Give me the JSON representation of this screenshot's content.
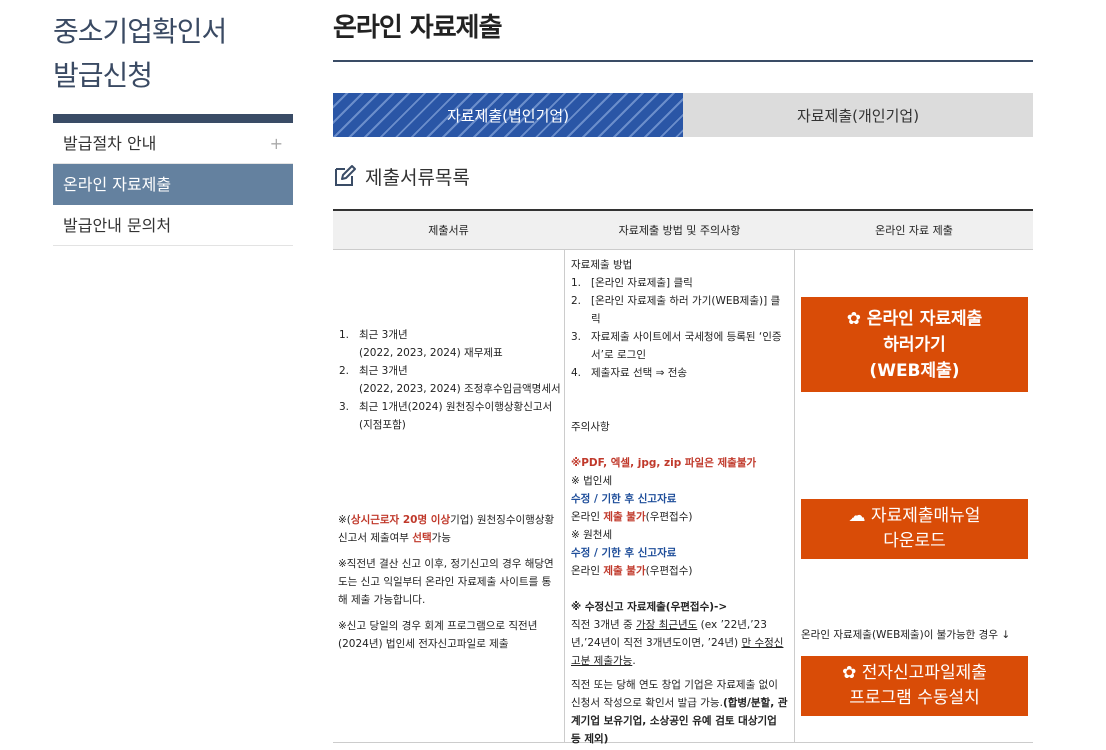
{
  "sidebar": {
    "title_line1": "중소기업확인서",
    "title_line2": "발급신청",
    "items": [
      {
        "label": "발급절차 안내",
        "plus": "+"
      },
      {
        "label": "온라인 자료제출"
      },
      {
        "label": "발급안내 문의처"
      }
    ]
  },
  "main": {
    "title": "온라인 자료제출",
    "tabs": [
      {
        "label": "자료제출(법인기업)"
      },
      {
        "label": "자료제출(개인기업)"
      }
    ],
    "section_title": "제출서류목록"
  },
  "table": {
    "headers": [
      "제출서류",
      "자료제출 방법 및 주의사항",
      "온라인 자료 제출"
    ],
    "docs": [
      {
        "num": "1.",
        "line1": "최근 3개년",
        "line2": "(2022, 2023, 2024) 재무제표"
      },
      {
        "num": "2.",
        "line1": "최근 3개년",
        "line2": "(2022, 2023, 2024) 조정후수입금액명세서"
      },
      {
        "num": "3.",
        "line1": "최근 1개년(2024) 원천징수이행상황신고서",
        "line2": "(지점포함)"
      }
    ],
    "note1": {
      "prefix": "※(",
      "highlight": "상시근로자 20명 이상",
      "mid": "기업) 원천징수이행상황신고서 제출여부 ",
      "highlight2": "선택",
      "suffix": "가능"
    },
    "note2": "※직전년 결산 신고 이후, 정기신고의 경우 해당연도는 신고 익일부터 온라인 자료제출 사이트를 통해 제출 가능합니다.",
    "note3": "※신고 당일의 경우 회계 프로그램으로 직전년(2024년) 법인세 전자신고파일로 제출",
    "method": {
      "heading": "자료제출 방법",
      "steps": [
        {
          "num": "1.",
          "text": "[온라인 자료제출] 클릭"
        },
        {
          "num": "2.",
          "text": "[온라인 자료제출 하러 가기(WEB제출)] 클릭"
        },
        {
          "num": "3.",
          "text": "자료제출 사이트에서 국세청에 등록된 ‘인증서’로 로그인"
        },
        {
          "num": "4.",
          "text": "제출자료 선택 ⇒ 전송"
        }
      ],
      "caution_heading": "주의사항",
      "caution_red": "※PDF, 엑셀, jpg, zip 파일은 제출불가",
      "corp_tax": "※ 법인세",
      "corp_blue": "수정 / 기한 후 신고자료",
      "corp_online": "온라인 ",
      "corp_red": "제출 불가",
      "corp_post": "(우편접수)",
      "wh_tax": "※ 원천세",
      "wh_blue": "수정 / 기한 후 신고자료",
      "wh_online": "온라인 ",
      "wh_red": "제출 불가",
      "wh_post": "(우편접수)",
      "amend_bold": "※ 수정신고 자료제출(우편접수)->",
      "amend_1": "직전 3개년 중 ",
      "amend_ul1": "가장 최근년도",
      "amend_2": " (ex ’22년,’23년,’24년이 직전 3개년도이면, ’24년) ",
      "amend_ul2": "만 수정신고분 제출가능",
      "amend_3": ".",
      "startup_1": "직전 또는 당해 연도 창업 기업은 자료제출 없이 신청서 작성으로 확인서 발급 가능.",
      "startup_bold": "(합병/분할, 관계기업 보유기업, 소상공인 유예 검토 대상기업 등 제외)"
    },
    "buttons": {
      "online_line1": "온라인 자료제출",
      "online_line2": "하러가기",
      "online_line3": "(WEB제출)",
      "manual_line1": "자료제출매뉴얼",
      "manual_line2": "다운로드",
      "web_note": "온라인 자료제출(WEB제출)이 불가능한 경우 ↓",
      "install_line1": "전자신고파일제출",
      "install_line2": "프로그램 수동설치"
    }
  }
}
